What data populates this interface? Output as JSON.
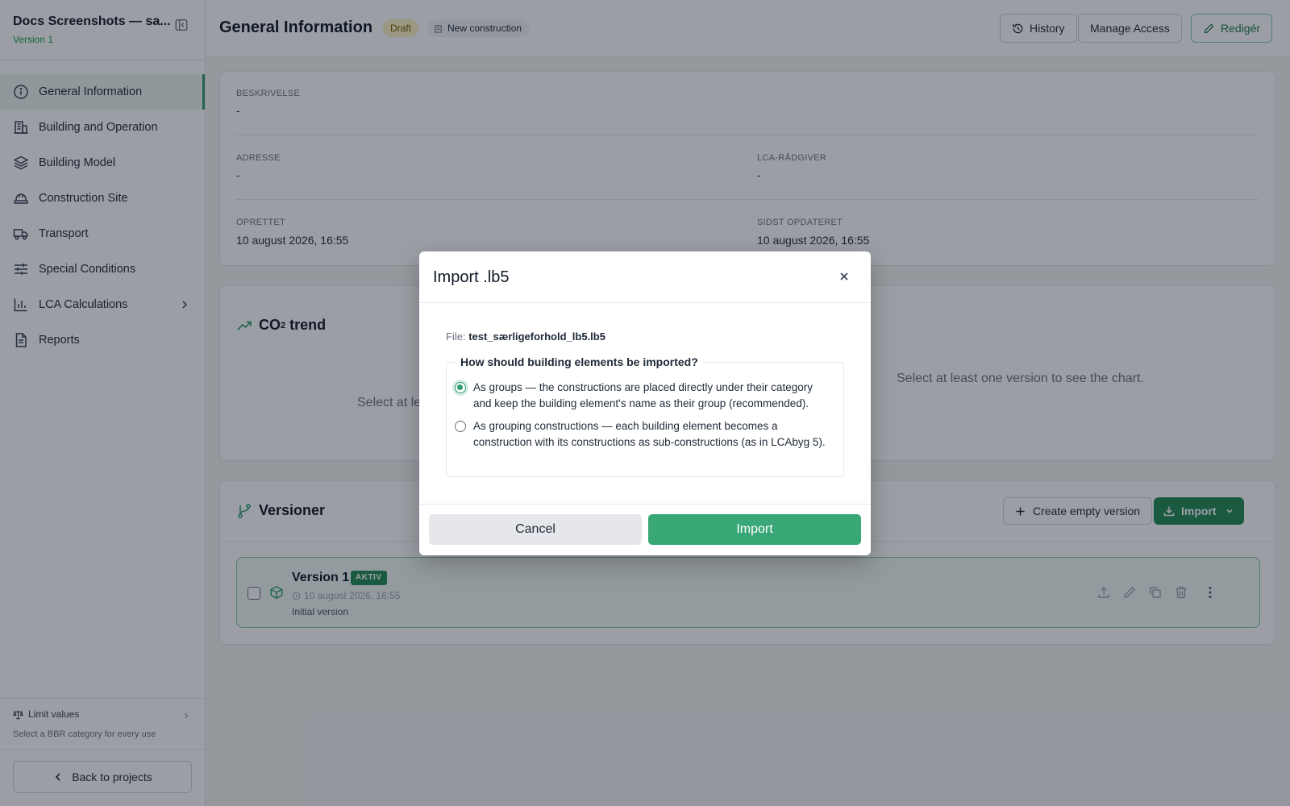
{
  "sidebar": {
    "project_title": "Docs Screenshots — sa...",
    "version_label": "Version 1",
    "items": [
      {
        "label": "General Information",
        "icon": "info-icon",
        "active": true
      },
      {
        "label": "Building and Operation",
        "icon": "building-icon"
      },
      {
        "label": "Building Model",
        "icon": "layers-icon"
      },
      {
        "label": "Construction Site",
        "icon": "hardhat-icon"
      },
      {
        "label": "Transport",
        "icon": "truck-icon"
      },
      {
        "label": "Special Conditions",
        "icon": "sliders-icon"
      },
      {
        "label": "LCA Calculations",
        "icon": "bar-chart-icon",
        "has_submenu": true
      },
      {
        "label": "Reports",
        "icon": "report-icon"
      }
    ],
    "limit_values": {
      "title": "Limit values",
      "subtitle": "Select a BBR category for every use"
    },
    "back_label": "Back to projects"
  },
  "header": {
    "title": "General Information",
    "status_badge": "Draft",
    "type_badge": "New construction",
    "history_label": "History",
    "manage_access_label": "Manage Access",
    "edit_label": "Redigér"
  },
  "info": {
    "description_label": "BESKRIVELSE",
    "description_value": "-",
    "address_label": "ADRESSE",
    "address_value": "-",
    "advisor_label": "LCA-RÅDGIVER",
    "advisor_value": "-",
    "created_label": "OPRETTET",
    "created_value": "10 august 2026, 16:55",
    "updated_label": "SIDST OPDATERET",
    "updated_value": "10 august 2026, 16:55"
  },
  "trend": {
    "title_main": "CO",
    "title_sub": "2",
    "title_rest": " trend",
    "empty_left": "Select at le",
    "empty_right": "Select at least one version to see the chart."
  },
  "versions": {
    "title": "Versioner",
    "create_label": "Create empty version",
    "import_label": "Import",
    "rows": [
      {
        "name": "Version 1",
        "badge": "AKTIV",
        "date": "10 august 2026, 16:55",
        "note": "Initial version"
      }
    ]
  },
  "modal": {
    "title": "Import .lb5",
    "file_label": "File:",
    "file_name": "test_særligeforhold_lb5.lb5",
    "question": "How should building elements be imported?",
    "options": [
      {
        "label": "As groups — the constructions are placed directly under their category and keep the building element's name as their group (recommended).",
        "selected": true
      },
      {
        "label": "As grouping constructions — each building element becomes a construction with its constructions as sub-constructions (as in LCAbyg 5).",
        "selected": false
      }
    ],
    "cancel_label": "Cancel",
    "import_label": "Import"
  },
  "colors": {
    "accent": "#2f9e6e",
    "primary_button": "#1f8a54",
    "draft_badge": "#fdf3c4",
    "overlay": "rgba(17,24,39,0.42)"
  }
}
